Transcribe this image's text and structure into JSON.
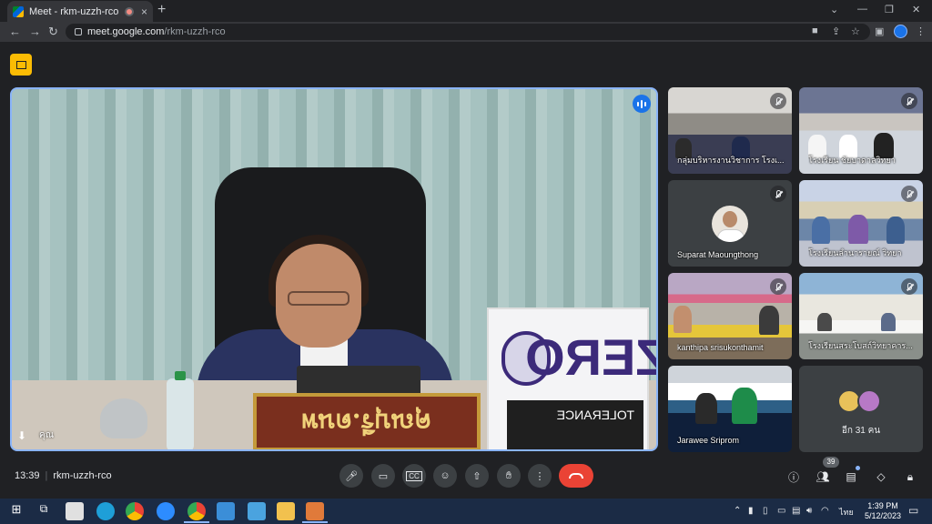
{
  "browser": {
    "tab_title": "Meet - rkm-uzzh-rco",
    "tab_close": "×",
    "new_tab": "+",
    "url_host": "meet.google.com",
    "url_path": "/rkm-uzzh-rco",
    "window_controls": [
      "⌄",
      "—",
      "❐",
      "✕"
    ]
  },
  "main_video": {
    "nameplate": "คุณบุรี.ดนพ",
    "poster_word": "ZERO",
    "poster_sub": "TOLERANCE",
    "speaker_label": "คุณ"
  },
  "tiles": [
    {
      "name": "กลุ่มบริหารงานวิชาการ โรงเ...",
      "scene": "scene-a",
      "muted": true
    },
    {
      "name": "โรงเรียน ชัยบาดาลวิทยา",
      "scene": "scene-b",
      "muted": true
    },
    {
      "name": "Suparat Maoungthong",
      "scene": "avatar",
      "muted": true
    },
    {
      "name": "โรงเรียนลำนารายณ์ วิทยา",
      "scene": "scene-c",
      "muted": true
    },
    {
      "name": "kanthipa srisukonthamit",
      "scene": "scene-d",
      "muted": true
    },
    {
      "name": "โรงเรียนสระโบสถ์วิทยาคาร...",
      "scene": "scene-e",
      "muted": true
    },
    {
      "name": "Jarawee Sriprom",
      "scene": "scene-f",
      "muted": false
    }
  ],
  "more_tile": {
    "label": "อีก 31 คน",
    "avatar_colors": [
      "#e8c15a",
      "#b779c6"
    ]
  },
  "controls": {
    "time": "13:39",
    "meeting_code": "rkm-uzzh-rco",
    "people_count": "39"
  },
  "taskbar": {
    "time": "1:39 PM",
    "date": "5/12/2023",
    "lang": "ไทย"
  },
  "colors": {
    "accent": "#8ab4f8",
    "end_call": "#ea4335",
    "host_controls": "#fbbc04"
  }
}
